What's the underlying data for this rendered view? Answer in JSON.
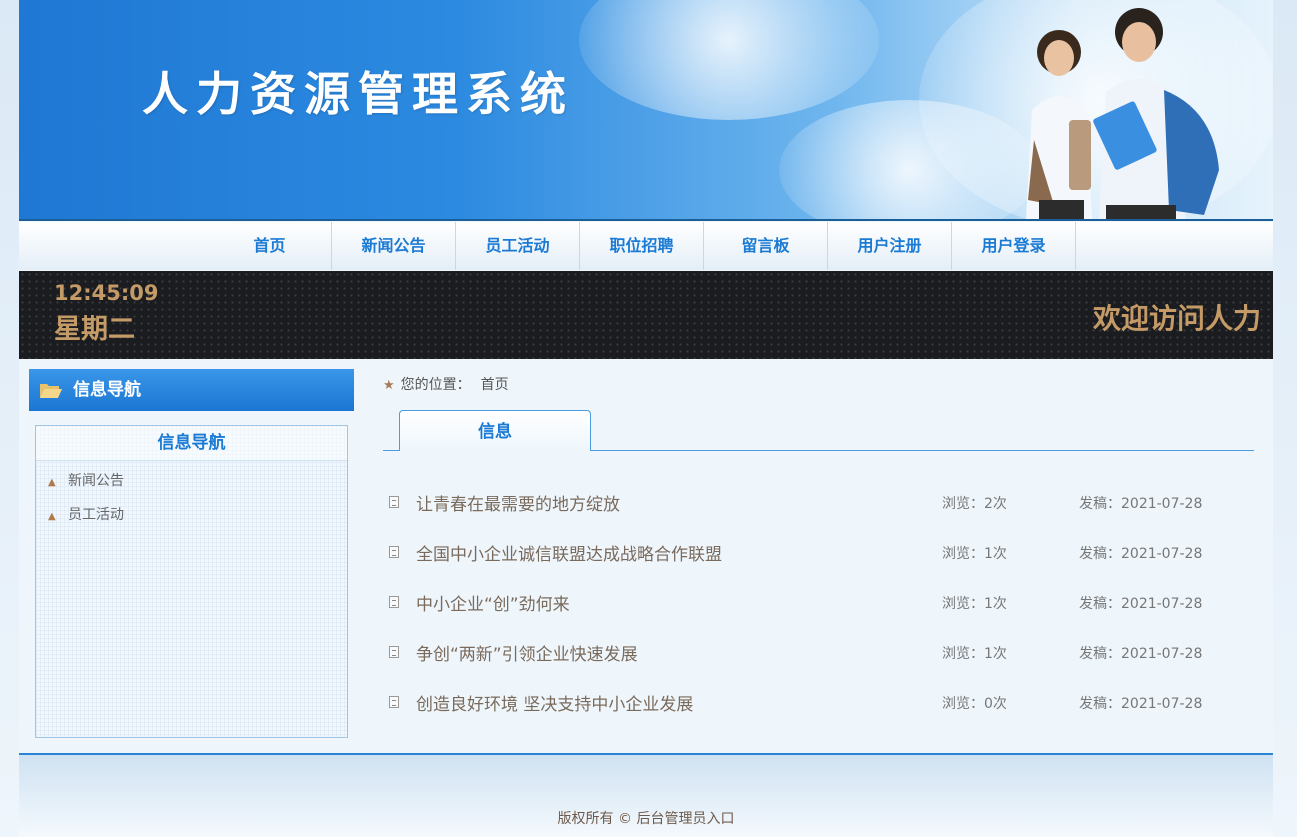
{
  "header": {
    "title": "人力资源管理系统"
  },
  "nav": {
    "items": [
      "首页",
      "新闻公告",
      "员工活动",
      "职位招聘",
      "留言板",
      "用户注册",
      "用户登录"
    ]
  },
  "infobar": {
    "time": "12:45:09",
    "day": "星期二",
    "welcome": "欢迎访问人力"
  },
  "sidebar": {
    "header_label": "信息导航",
    "box_title": "信息导航",
    "links": [
      "新闻公告",
      "员工活动"
    ]
  },
  "breadcrumb": {
    "label": "您的位置：",
    "current": "首页"
  },
  "tab": {
    "label": "信息"
  },
  "news": [
    {
      "title": "让青春在最需要的地方绽放",
      "views": "浏览：2次",
      "date": "发稿：2021-07-28"
    },
    {
      "title": "全国中小企业诚信联盟达成战略合作联盟",
      "views": "浏览：1次",
      "date": "发稿：2021-07-28"
    },
    {
      "title": "中小企业“创”劲何来",
      "views": "浏览：1次",
      "date": "发稿：2021-07-28"
    },
    {
      "title": "争创“两新”引领企业快速发展",
      "views": "浏览：1次",
      "date": "发稿：2021-07-28"
    },
    {
      "title": "创造良好环境 坚决支持中小企业发展",
      "views": "浏览：0次",
      "date": "发稿：2021-07-28"
    }
  ],
  "footer": {
    "copyright": "版权所有 © ",
    "admin_link": "后台管理员入口"
  },
  "colors": {
    "accent": "#1b7bd4",
    "warm": "#c49a67",
    "dark": "#1b1c20"
  }
}
